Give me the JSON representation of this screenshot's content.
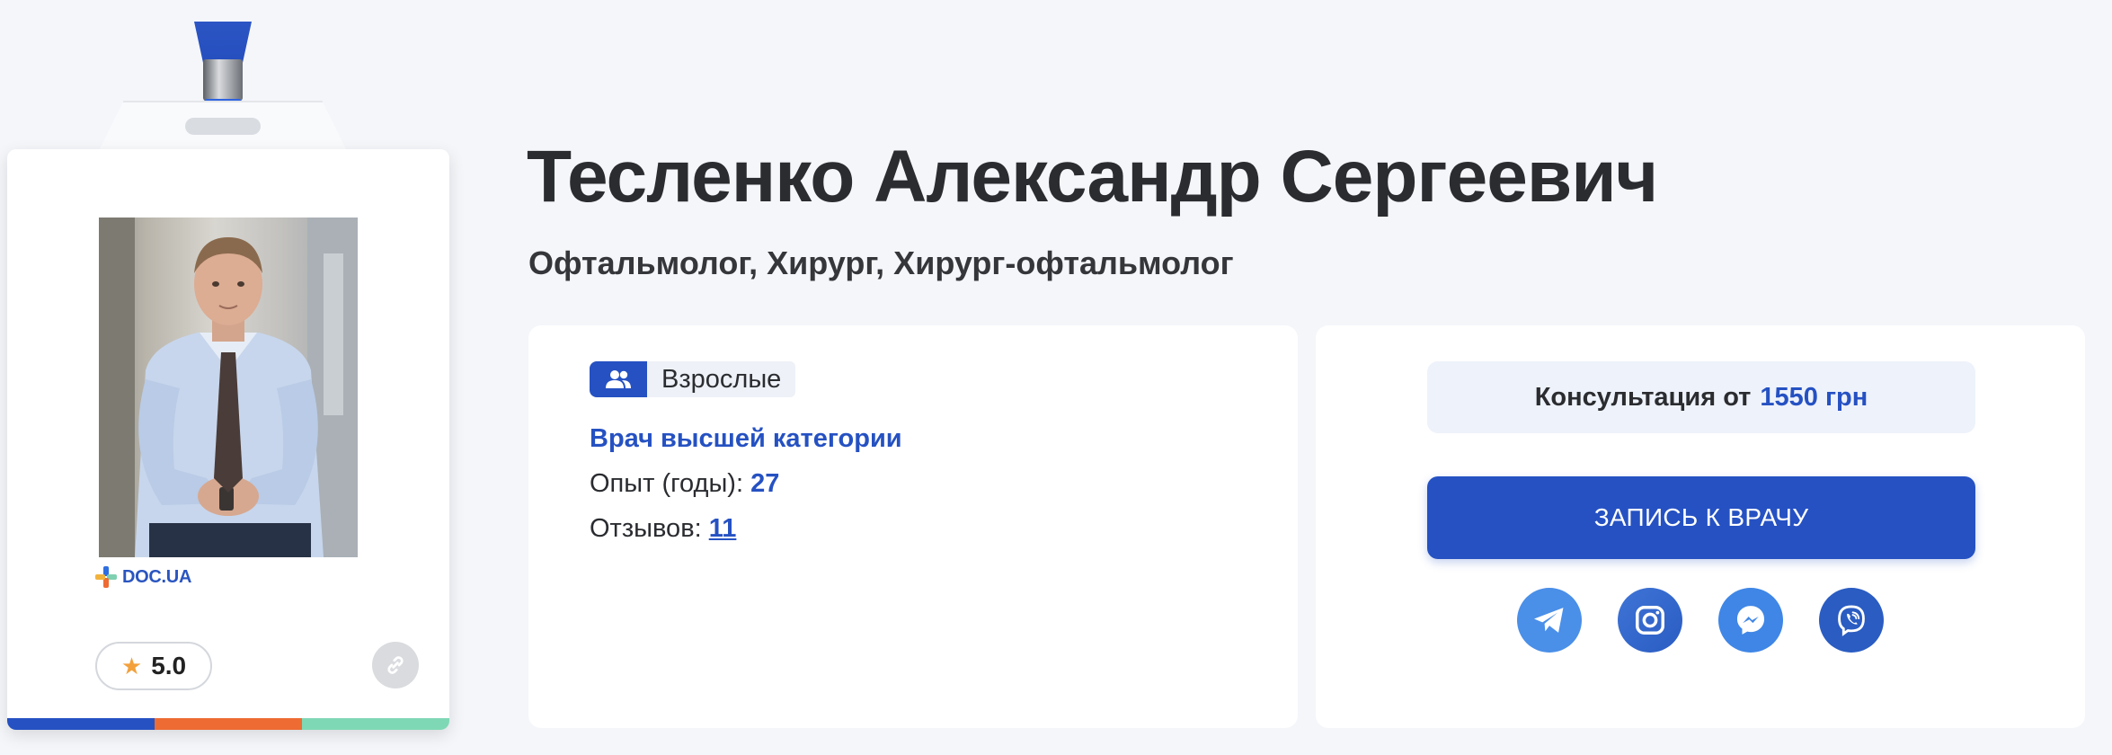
{
  "doctor": {
    "name": "Тесленко Александр Сергеевич",
    "specialties": "Офтальмолог, Хирург, Хирург-офтальмолог"
  },
  "badge": {
    "logo_text": "DOC.UA",
    "rating": "5.0",
    "stripe_colors": [
      "#2551c2",
      "#ee6b33",
      "#7fd8b5"
    ]
  },
  "info": {
    "age_group": "Взрослые",
    "category": "Врач высшей категории",
    "experience_label": "Опыт (годы):",
    "experience_value": "27",
    "reviews_label": "Отзывов:",
    "reviews_value": "11"
  },
  "booking": {
    "price_label": "Консультация от",
    "price_value": "1550 грн",
    "button_label": "ЗАПИСЬ К ВРАЧУ",
    "socials": [
      "telegram-icon",
      "instagram-icon",
      "messenger-icon",
      "viber-icon"
    ]
  },
  "colors": {
    "accent": "#2551c2",
    "background": "#f4f6fa",
    "star": "#f2a13c"
  }
}
